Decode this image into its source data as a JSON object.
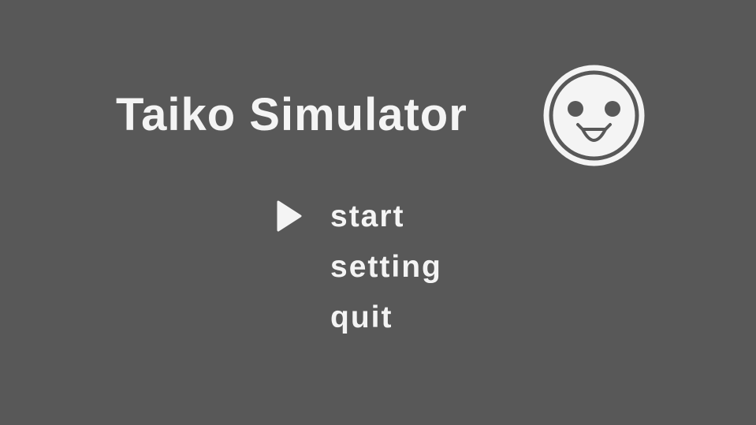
{
  "title": "Taiko Simulator",
  "logo_icon": "smiling-drum-face-icon",
  "menu": {
    "selected_index": 0,
    "items": [
      {
        "label": "start"
      },
      {
        "label": "setting"
      },
      {
        "label": "quit"
      }
    ]
  },
  "cursor_icon": "triangle-pointer-icon",
  "colors": {
    "background": "#585858",
    "foreground": "#f4f4f4"
  }
}
